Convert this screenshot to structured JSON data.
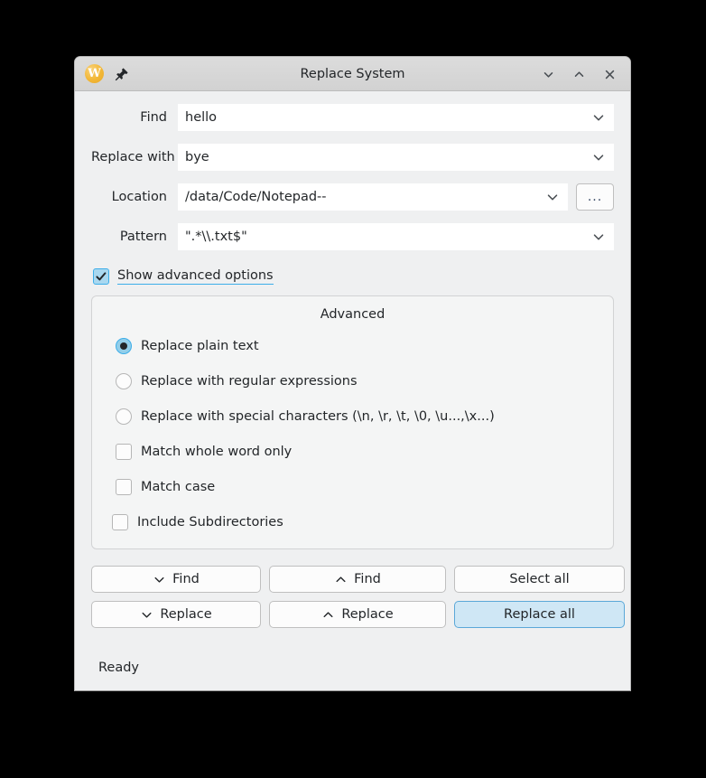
{
  "window": {
    "title": "Replace System",
    "app_icon": "w-logo-icon",
    "pin_icon": "pin-icon",
    "controls": [
      {
        "name": "minimize-button",
        "icon": "chevron-down-icon"
      },
      {
        "name": "maximize-button",
        "icon": "chevron-up-icon"
      },
      {
        "name": "close-button",
        "icon": "close-icon"
      }
    ]
  },
  "form": {
    "find": {
      "label": "Find",
      "value": "hello"
    },
    "replace_with": {
      "label": "Replace with",
      "value": "bye"
    },
    "location": {
      "label": "Location",
      "value": "/data/Code/Notepad--",
      "browse_label": "..."
    },
    "pattern": {
      "label": "Pattern",
      "value": "\".*\\\\.txt$\""
    }
  },
  "advanced_toggle": {
    "label": "Show advanced options",
    "checked": true
  },
  "advanced": {
    "title": "Advanced",
    "radios": [
      {
        "label": "Replace plain text",
        "selected": true
      },
      {
        "label": "Replace with regular expressions",
        "selected": false
      },
      {
        "label": "Replace with special characters (\\n, \\r, \\t, \\0, \\u...,\\x...)",
        "selected": false
      }
    ],
    "checkboxes": [
      {
        "label": "Match whole word only",
        "checked": false
      },
      {
        "label": "Match case",
        "checked": false
      },
      {
        "label": "Include Subdirectories",
        "checked": false
      }
    ]
  },
  "buttons": {
    "find_next": "Find",
    "find_prev": "Find",
    "select_all": "Select all",
    "replace_next": "Replace",
    "replace_prev": "Replace",
    "replace_all": "Replace all"
  },
  "status": {
    "text": "Ready",
    "progress_style": "segmented",
    "progress_track_color": "#bcdcf0",
    "progress_chunk_color": "#3daee9"
  },
  "colors": {
    "accent": "#3daee9",
    "dialog_bg": "#eff0f1",
    "field_bg": "#ffffff",
    "text": "#232629",
    "app_icon": "#f2b736"
  }
}
